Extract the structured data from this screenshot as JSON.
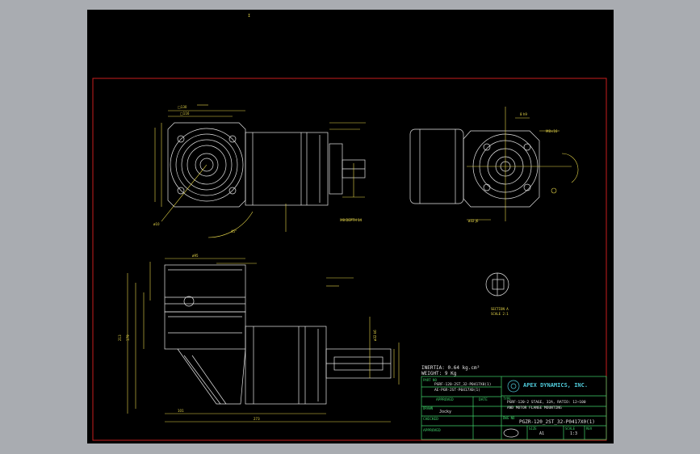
{
  "window": {
    "background": "#a9acb1",
    "canvas_bg": "#000000"
  },
  "colors": {
    "frame": "#c81e1e",
    "outline": "#e6e6e6",
    "dimension": "#e8d84a",
    "title_block": "#3fd36a",
    "brand": "#4fc9d8"
  },
  "title_block": {
    "part_no_label": "PART NO",
    "part_no_line1": "PGRF-120-2ST_32-P0417X0(1)",
    "part_no_line2": "AE-PGR-2ST-P0417X0(1)",
    "approved_label": "APPROVED",
    "date_label": "DATE",
    "drawn_label": "DRAWN",
    "drawn_value": "Jocky",
    "checked_label": "CHECKED",
    "approved2_label": "APPROVED",
    "type_label": "TYPE",
    "type_line1": "PGRF-120-2 STAGE, 32A, RATIO: 12~100",
    "type_line2": "AND MOTOR FLANGE MOUNTING",
    "company": "APEX DYNAMICS, INC.",
    "dwg_no_label": "DWG NO",
    "dwg_no": "PGZR-120_2ST_32-P0417X0(1)",
    "size_label": "SIZE",
    "size_value": "A1",
    "scale_label": "SCALE",
    "scale_value": "1:3",
    "rev_label": "REV"
  },
  "notes": {
    "inertia": "INERTIA: 0.64 kg.cm²",
    "weight": "WEIGHT: 9 Kg",
    "section_a": "SECTION A",
    "section_scale": "SCALE 2:1"
  }
}
